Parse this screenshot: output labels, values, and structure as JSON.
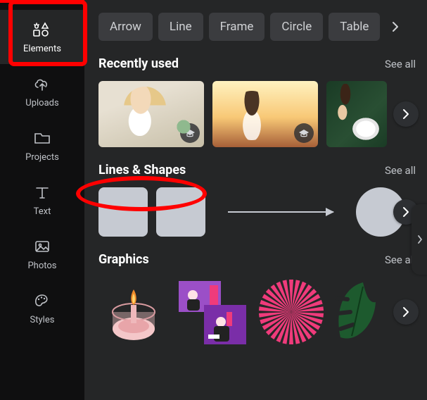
{
  "sidebar": {
    "items": [
      {
        "label": "Elements"
      },
      {
        "label": "Uploads"
      },
      {
        "label": "Projects"
      },
      {
        "label": "Text"
      },
      {
        "label": "Photos"
      },
      {
        "label": "Styles"
      }
    ]
  },
  "chips": {
    "items": [
      "Arrow",
      "Line",
      "Frame",
      "Circle",
      "Table"
    ]
  },
  "sections": {
    "recent": {
      "title": "Recently used",
      "see_all": "See all"
    },
    "lines": {
      "title": "Lines & Shapes",
      "see_all": "See all"
    },
    "graphics": {
      "title": "Graphics",
      "see_all": "See all"
    }
  }
}
